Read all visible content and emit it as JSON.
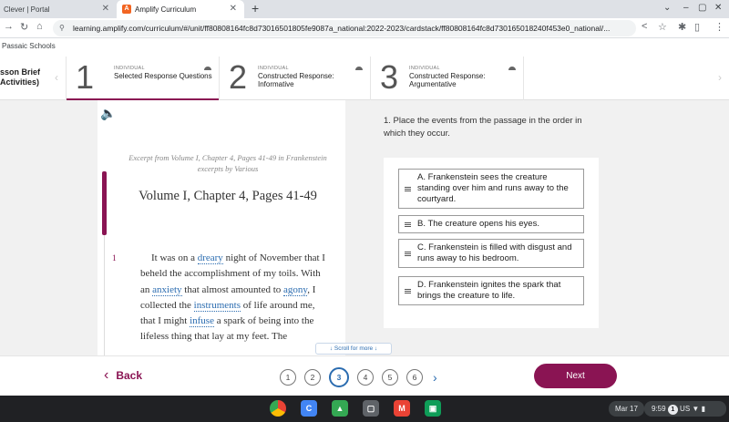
{
  "browser": {
    "tabs": [
      {
        "label": "Clever | Portal",
        "active": false
      },
      {
        "label": "Amplify Curriculum",
        "active": true
      }
    ],
    "new_tab_icon": "+",
    "url": "learning.amplify.com/curriculum/#/unit/ff80808164fc8d73016501805fe9087a_national:2022-2023/cardstack/ff80808164fc8d730165018240f453e0_national/...",
    "bookmark": "Passaic Schools"
  },
  "lesson": {
    "brief_title": "sson Brief",
    "brief_sub": "Activities)",
    "steps": [
      {
        "number": "1",
        "kind": "INDIVIDUAL",
        "title": "Selected Response Questions",
        "active": true
      },
      {
        "number": "2",
        "kind": "INDIVIDUAL",
        "title": "Constructed Response: Informative",
        "active": false
      },
      {
        "number": "3",
        "kind": "INDIVIDUAL",
        "title": "Constructed Response: Argumentative",
        "active": false
      }
    ]
  },
  "passage": {
    "excerpt": "Excerpt from Volume I, Chapter 4, Pages 41-49 in Frankenstein excerpts by Various",
    "chapter": "Volume I, Chapter 4, Pages 41-49",
    "paragraph_number": "1",
    "text": {
      "t1": "It was on a ",
      "v1": "dreary",
      "t2": " night of November that I beheld the accomplishment of my toils. With an ",
      "v2": "anxiety",
      "t3": " that almost amounted to ",
      "v3": "agony",
      "t4": ", I collected the ",
      "v4": "instruments",
      "t5": " of life around me, that I might ",
      "v5": "infuse",
      "t6": " a spark of being into the lifeless thing that lay at my feet. The"
    },
    "scroll_more": "↓  Scroll for more  ↓"
  },
  "question": {
    "prompt": "1. Place the events from the passage in the order in which they occur.",
    "options": [
      "A. Frankenstein sees the creature standing over him and runs away to the courtyard.",
      "B. The creature opens his eyes.",
      "C. Frankenstein is filled with disgust and runs away to his bedroom.",
      "D. Frankenstein ignites the spark that brings the creature to life."
    ]
  },
  "footer": {
    "back_label": "Back",
    "pages": [
      "1",
      "2",
      "3",
      "4",
      "5",
      "6"
    ],
    "current_page": "3",
    "next_label": "Next"
  },
  "shelf": {
    "date": "Mar 17",
    "time": "9:59",
    "notifications": "1",
    "locale": "US"
  },
  "colors": {
    "accent": "#8a1453",
    "link": "#2b6cb0"
  }
}
